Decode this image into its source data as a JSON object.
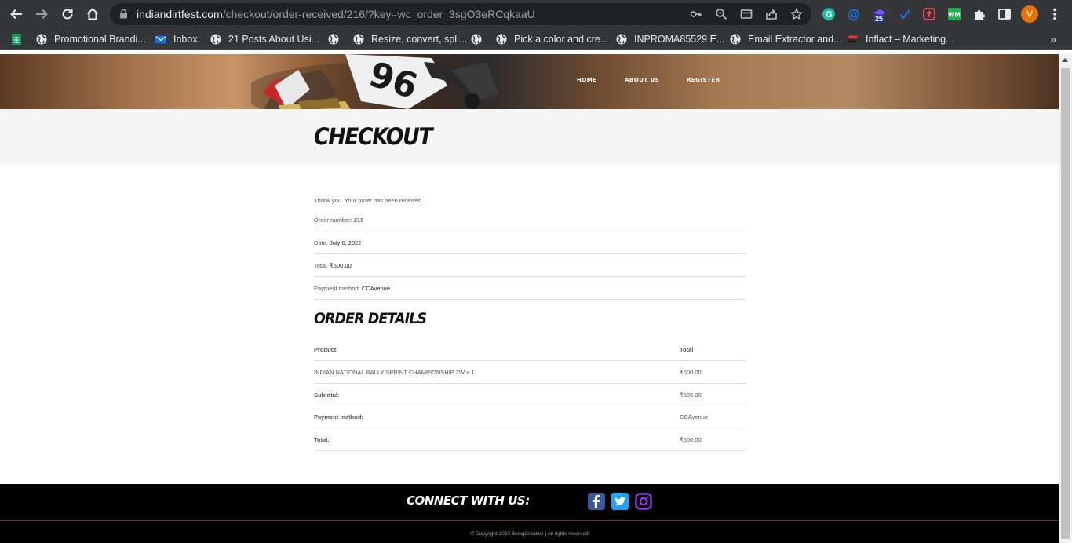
{
  "browser": {
    "url_host": "indiandirtfest.com",
    "url_path": "/checkout/order-received/216/?key=wc_order_3sgO3eRCqkaaU",
    "extension_badge": "25",
    "profile_initial": "V",
    "bookmarks": [
      {
        "label": "",
        "icon": "sheets-icon"
      },
      {
        "label": "Promotional Brandi...",
        "icon": "globe-icon"
      },
      {
        "label": "Inbox",
        "icon": "mail-icon"
      },
      {
        "label": "21 Posts About Usi...",
        "icon": "globe-icon"
      },
      {
        "label": "",
        "icon": "globe-icon"
      },
      {
        "label": "Resize, convert, spli...",
        "icon": "globe-icon"
      },
      {
        "label": "",
        "icon": "globe-icon"
      },
      {
        "label": "Pick a color and cre...",
        "icon": "globe-icon"
      },
      {
        "label": "INPROMA85529 E...",
        "icon": "globe-icon"
      },
      {
        "label": "Email Extractor and...",
        "icon": "globe-icon"
      },
      {
        "label": "Inflact – Marketing...",
        "icon": "inflact-icon"
      }
    ],
    "more_bookmarks": "»"
  },
  "site": {
    "nav": [
      "HOME",
      "ABOUT US",
      "REGISTER"
    ]
  },
  "page": {
    "title": "CHECKOUT",
    "thanks": "Thank you. Your order has been received.",
    "overview": [
      {
        "label": "Order number:",
        "value": "216"
      },
      {
        "label": "Date:",
        "value": "July 6, 2022"
      },
      {
        "label": "Total:",
        "value": "₹500.00"
      },
      {
        "label": "Payment method:",
        "value": "CCAvenue"
      }
    ],
    "order_details_title": "ORDER DETAILS",
    "table": {
      "headers": [
        "Product",
        "Total"
      ],
      "rows": [
        {
          "label": "INDIAN NATIONAL RALLY SPRINT CHAMPIONSHIP 2W × 1",
          "value": "₹500.00",
          "bold": false
        },
        {
          "label": "Subtotal:",
          "value": "₹500.00",
          "bold": true
        },
        {
          "label": "Payment method:",
          "value": "CCAvenue",
          "bold": true
        },
        {
          "label": "Total:",
          "value": "₹500.00",
          "bold": true
        }
      ]
    }
  },
  "footer": {
    "connect": "CONNECT WITH US:",
    "copyright": "© Copyright 2022 BeingCreative | All rights reserved"
  },
  "colors": {
    "chrome": "#35363a",
    "footer": "#000000",
    "facebook": "#3b5998",
    "twitter": "#1da1f2",
    "instagram": "#8e3bd6"
  }
}
